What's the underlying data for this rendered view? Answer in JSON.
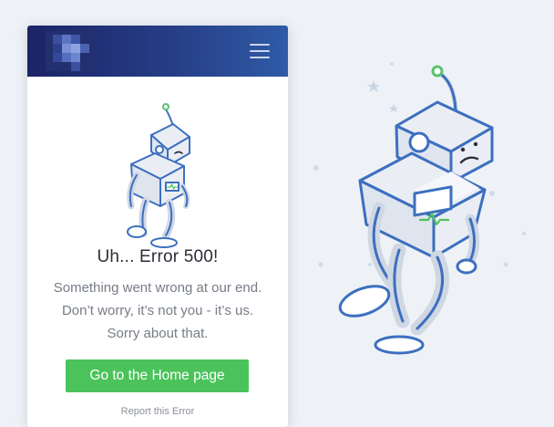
{
  "header": {
    "logo_icon": "pixelated-logo-icon",
    "menu_icon": "hamburger-menu-icon"
  },
  "error": {
    "title": "Uh... Error 500!",
    "message_lines": [
      "Something went wrong at our end.",
      "Don’t worry, it’s not you - it’s us.",
      "Sorry about that."
    ]
  },
  "actions": {
    "home_button_label": "Go to the Home page",
    "report_link_label": "Report this Error"
  },
  "illustration": {
    "name": "sad-robot-illustration-icon",
    "colors": {
      "outline": "#3d6fbf",
      "fill": "#e9edf3",
      "monitor": "#4bc35a",
      "antenna_tip": "#5ac36d"
    }
  },
  "theme": {
    "header_dark": "#1b2466",
    "header_light": "#2f5ba6",
    "button": "#4bc35a",
    "background": "#eef2f6"
  }
}
